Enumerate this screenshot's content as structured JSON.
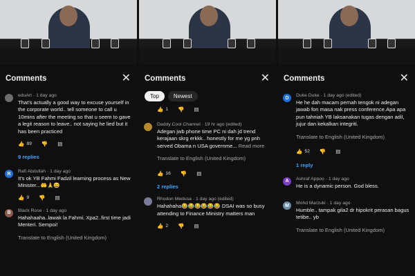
{
  "panels": [
    {
      "header": {
        "title": "Comments"
      },
      "comments": [
        {
          "author": "eduArt",
          "time": "1 day ago",
          "initial": "",
          "avatar_color": "#6e6e6e",
          "text": "That's actually a good way to excuse yourself in the corporate world.. tell someone to call u 10mins after the meeting so that u seem to gave a legit reason to leave.. not saying he lied but it has been practiced",
          "likes": "89",
          "replies_label": "9 replies"
        },
        {
          "author": "Rafi Abdullah",
          "time": "1 day ago",
          "initial": "R",
          "avatar_color": "#1e6fd9",
          "text": "It's ok YB Fahmi Fadzil learning process as New Minister...🤲🙏😄",
          "likes": "9"
        },
        {
          "author": "Black Rose",
          "time": "1 day ago",
          "initial": "B",
          "avatar_color": "#8a5a4a",
          "text": "Hahahaaha..lawak la Fahmi. Xpa2..first time jadi Menteri. Sempoi!",
          "translate": "Translate to English (United Kingdom)"
        }
      ]
    },
    {
      "header": {
        "title": "Comments"
      },
      "chips": [
        "Top",
        "Newest"
      ],
      "comments": [
        {
          "author": "",
          "time": "",
          "text": "",
          "likes": "1"
        },
        {
          "author": "Daddy Cool Channel",
          "time": "19 hr ago (edited)",
          "initial": "",
          "avatar_color": "#b58a2a",
          "text": "Adegan jwb phone time PC ni dah jd trend kerajaan skrg erkkk.. honestly for me yg pnh served Obama n USA governme...",
          "more": "Read more",
          "translate": "Translate to English (United Kingdom)",
          "likes": "16",
          "replies_label": "2 replies"
        },
        {
          "author": "Rhodon Medusa",
          "time": "1 day ago (edited)",
          "initial": "",
          "avatar_color": "#7a7a9a",
          "text": "Hahahaha😂😂😂😂😂😂 DSAI was so busy attending to Finance Ministry matters man",
          "likes": "2"
        }
      ]
    },
    {
      "header": {
        "title": "Comments"
      },
      "comments": [
        {
          "author": "Duke Duke",
          "time": "1 day ago (edited)",
          "initial": "D",
          "avatar_color": "#1e6fd9",
          "text": "He he dah macam pernah tengok ni adegan jawab fon masa nak press conference.Apa apa pun tahniah YB laksanakan tugas dengan adil, jujur dan kekalkan integriti.",
          "translate": "Translate to English (United Kingdom)",
          "likes": "52",
          "replies_label": "1 reply"
        },
        {
          "author": "Ashraf Appoo",
          "time": "1 day ago",
          "initial": "A",
          "avatar_color": "#7b3fc4",
          "text": "He is a dynamic person. God bless."
        },
        {
          "author": "Mohd Marzuki",
          "time": "1 day ago",
          "initial": "M",
          "avatar_color": "#6c8fa8",
          "text": "Humble.. tampak gila2 dr hipokrit perasan bagus tetibe.. yb",
          "translate": "Translate to English (United Kingdom)"
        }
      ]
    }
  ]
}
